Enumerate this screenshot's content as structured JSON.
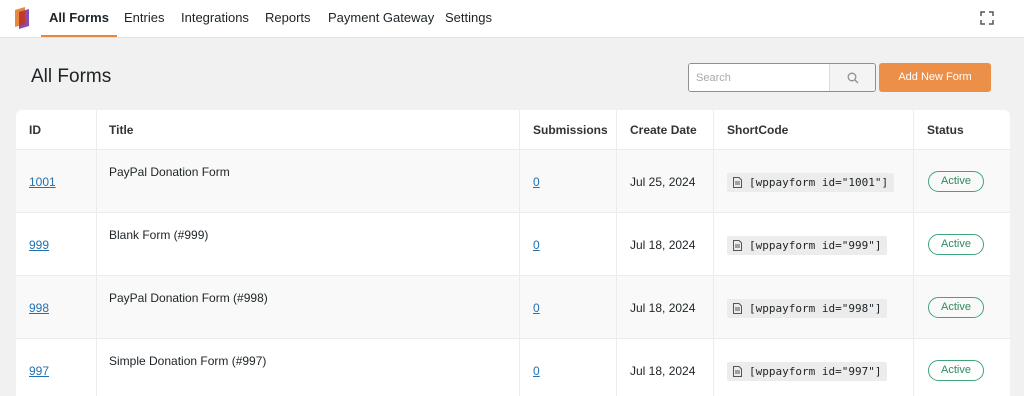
{
  "nav": {
    "items": [
      {
        "label": "All Forms",
        "active": true
      },
      {
        "label": "Entries"
      },
      {
        "label": "Integrations"
      },
      {
        "label": "Reports"
      },
      {
        "label": "Payment Gateway"
      },
      {
        "label": "Settings"
      }
    ],
    "logo_icon": "wppayform-logo-icon",
    "expand_icon": "fullscreen-expand-icon"
  },
  "page": {
    "title": "All Forms",
    "search_placeholder": "Search",
    "add_button": "Add New Form"
  },
  "colors": {
    "accent": "#ec8f49",
    "link": "#2271b1",
    "status_active": "#2e8a5f"
  },
  "table": {
    "columns": [
      "ID",
      "Title",
      "Submissions",
      "Create Date",
      "ShortCode",
      "Status"
    ],
    "rows": [
      {
        "id": "1001",
        "title": "PayPal Donation Form",
        "submissions": "0",
        "date": "Jul 25, 2024",
        "shortcode": "[wppayform id=\"1001\"]",
        "status": "Active"
      },
      {
        "id": "999",
        "title": "Blank Form (#999)",
        "submissions": "0",
        "date": "Jul 18, 2024",
        "shortcode": "[wppayform id=\"999\"]",
        "status": "Active"
      },
      {
        "id": "998",
        "title": "PayPal Donation Form (#998)",
        "submissions": "0",
        "date": "Jul 18, 2024",
        "shortcode": "[wppayform id=\"998\"]",
        "status": "Active"
      },
      {
        "id": "997",
        "title": "Simple Donation Form (#997)",
        "submissions": "0",
        "date": "Jul 18, 2024",
        "shortcode": "[wppayform id=\"997\"]",
        "status": "Active"
      }
    ]
  }
}
